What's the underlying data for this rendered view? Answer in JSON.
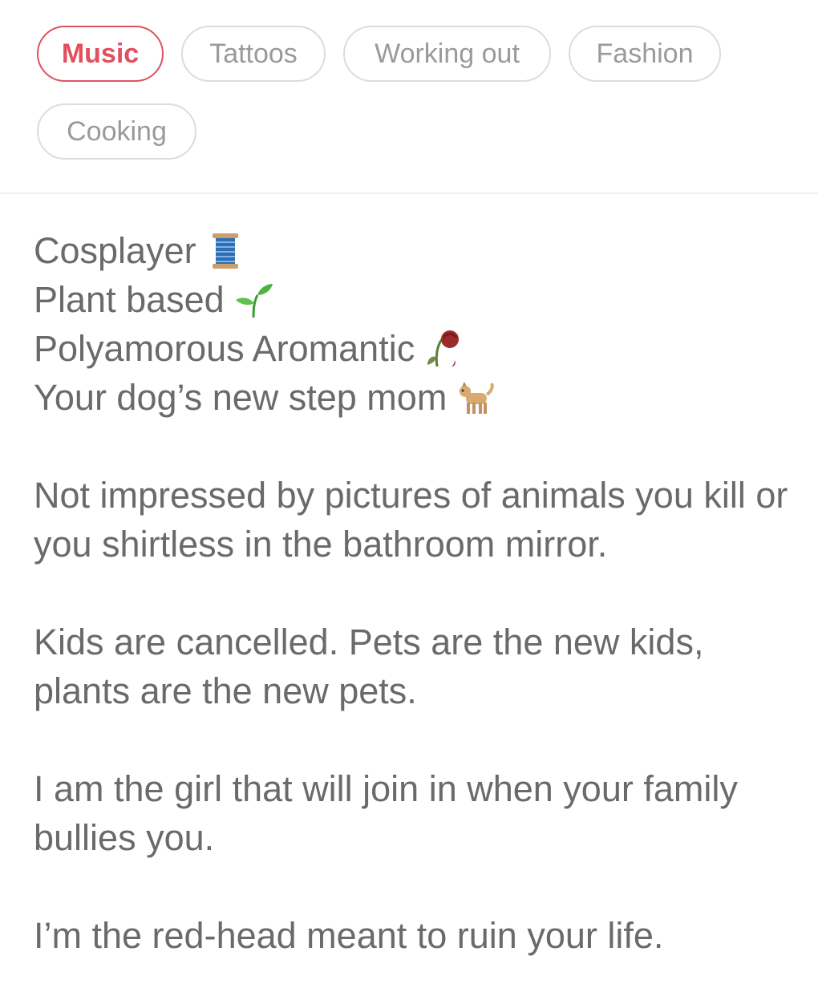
{
  "interests": {
    "chips": [
      {
        "label": "Music",
        "selected": true
      },
      {
        "label": "Tattoos",
        "selected": false
      },
      {
        "label": "Working out",
        "selected": false
      },
      {
        "label": "Fashion",
        "selected": false
      },
      {
        "label": "Cooking",
        "selected": false
      }
    ]
  },
  "bio": {
    "lines": [
      {
        "text": "Cosplayer",
        "icon": "spool-of-thread-icon"
      },
      {
        "text": "Plant based",
        "icon": "seedling-icon"
      },
      {
        "text": "Polyamorous Aromantic",
        "icon": "wilted-rose-icon"
      },
      {
        "text": "Your dog’s new step mom",
        "icon": "dog-icon"
      }
    ],
    "paragraphs": [
      "Not impressed by pictures of animals you kill or you shirtless in the bathroom mirror.",
      "Kids are cancelled. Pets are the new kids, plants are the new pets.",
      "I am the girl that will join in when your family bullies you.",
      "I’m the red-head meant to ruin your life."
    ]
  },
  "colors": {
    "accent": "#e0505f",
    "chip_border": "#dcdcdc",
    "chip_text": "#9a9a9a",
    "body_text": "#6a6a6a",
    "divider": "#efefef"
  }
}
